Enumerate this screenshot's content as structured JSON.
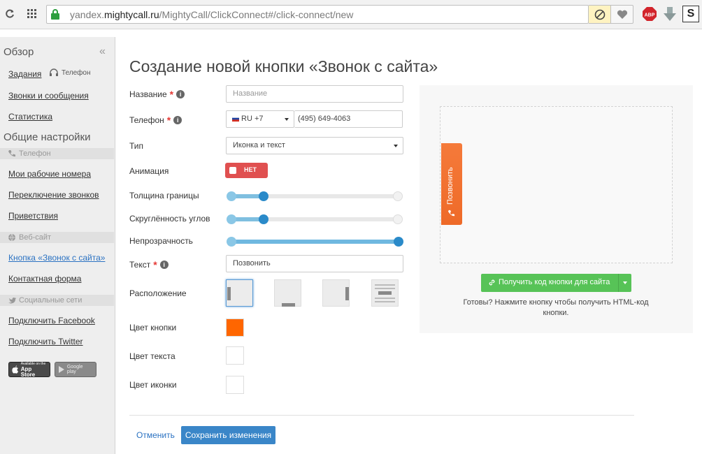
{
  "browser": {
    "url_host_prefix": "yandex.",
    "url_host_main": "mightycall.ru",
    "url_path": "/MightyCall/ClickConnect#/click-connect/new",
    "abp_label": "ABP",
    "ext_s_label": "S"
  },
  "sidebar": {
    "section_overview": "Обзор",
    "tasks": "Задания",
    "phone_status": "Телефон",
    "calls_messages": "Звонки и сообщения",
    "statistics": "Статистика",
    "section_settings": "Общие настройки",
    "group_phone": "Телефон",
    "my_numbers": "Мои рабочие номера",
    "call_switching": "Переключение звонков",
    "greetings": "Приветствия",
    "group_website": "Веб-сайт",
    "call_button": "Кнопка «Звонок с сайта»",
    "contact_form": "Контактная форма",
    "group_social": "Социальные сети",
    "connect_facebook": "Подключить Facebook",
    "connect_twitter": "Подключить Twitter",
    "app_store": "App Store",
    "app_store_small": "Available on the",
    "google_play": "Google play"
  },
  "form": {
    "title": "Создание новой кнопки «Звонок с сайта»",
    "name_label": "Название",
    "name_placeholder": "Название",
    "phone_label": "Телефон",
    "country_code": "RU +7",
    "phone_value": "(495) 649-4063",
    "type_label": "Тип",
    "type_value": "Иконка и текст",
    "animation_label": "Анимация",
    "animation_toggle": "НЕТ",
    "border_label": "Толщина границы",
    "border_value": 0.2,
    "corner_label": "Скруглённость углов",
    "corner_value": 0.2,
    "opacity_label": "Непрозрачность",
    "opacity_value": 1.0,
    "text_label": "Текст",
    "text_value": "Позвонить",
    "position_label": "Расположение",
    "button_color_label": "Цвет кнопки",
    "button_color": "#ff6600",
    "text_color_label": "Цвет текста",
    "text_color": "#ffffff",
    "icon_color_label": "Цвет иконки",
    "icon_color": "#ffffff",
    "cancel": "Отменить",
    "save": "Сохранить изменения"
  },
  "preview": {
    "call_tab_text": "Позвонить",
    "get_code_button": "Получить код кнопки для сайта",
    "ready_text": "Готовы? Нажмите кнопку чтобы получить HTML-код кнопки."
  }
}
